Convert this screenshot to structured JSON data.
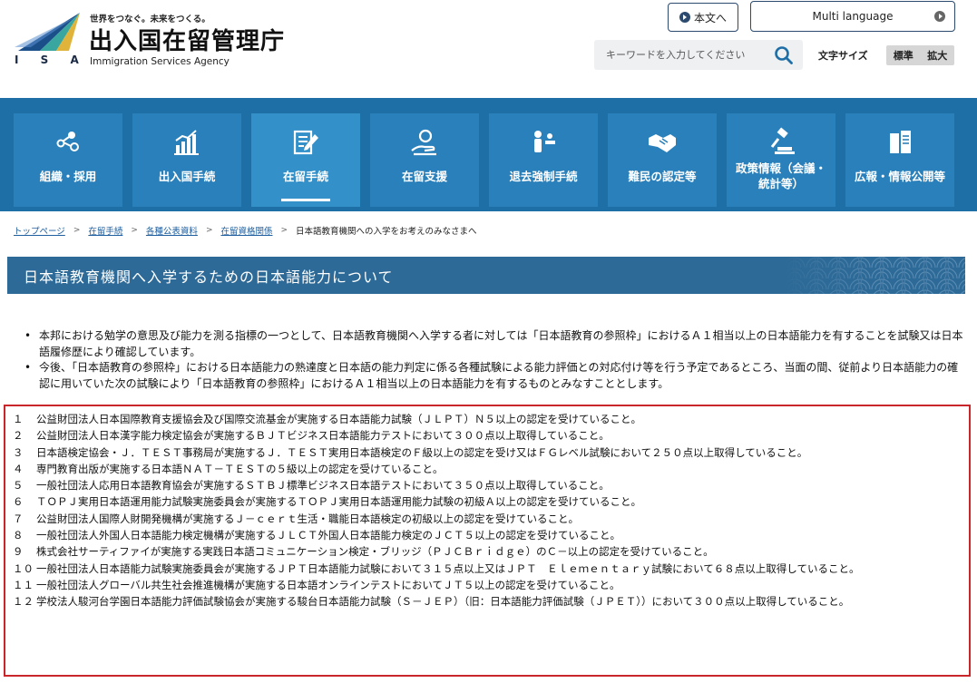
{
  "header": {
    "tagline": "世界をつなぐ。未来をつくる。",
    "agency_name": "出入国在留管理庁",
    "agency_english": "Immigration Services Agency",
    "logo_abbr": "I S A",
    "honbun_label": "本文へ",
    "multi_language_label": "Multi language",
    "search_placeholder": "キーワードを入力してください",
    "font_size_label": "文字サイズ",
    "font_size_options": [
      "標準",
      "拡大"
    ]
  },
  "nav": {
    "items": [
      {
        "label": "組織・採用",
        "icon": "organization-icon"
      },
      {
        "label": "出入国手続",
        "icon": "chart-icon"
      },
      {
        "label": "在留手続",
        "icon": "document-pen-icon",
        "active": true
      },
      {
        "label": "在留支援",
        "icon": "support-hand-icon"
      },
      {
        "label": "退去強制手続",
        "icon": "people-icon"
      },
      {
        "label": "難民の認定等",
        "icon": "handshake-icon"
      },
      {
        "label": "政策情報（会議・\n統計等）",
        "icon": "gavel-icon"
      },
      {
        "label": "広報・情報公開等",
        "icon": "books-icon"
      }
    ]
  },
  "breadcrumb": {
    "items": [
      "トップページ",
      "在留手続",
      "各種公表資料",
      "在留資格関係"
    ],
    "current": "日本語教育機関への入学をお考えのみなさまへ"
  },
  "page_title": "日本語教育機関へ入学するための日本語能力について",
  "intro": [
    "本邦における勉学の意思及び能力を測る指標の一つとして、日本語教育機関へ入学する者に対しては「日本語教育の参照枠」におけるＡ１相当以上の日本語能力を有することを試験又は日本語履修歴により確認しています。",
    "今後、「日本語教育の参照枠」における日本語能力の熟達度と日本語の能力判定に係る各種試験による能力評価との対応付け等を行う予定であるところ、当面の間、従前より日本語能力の確認に用いていた次の試験により「日本語教育の参照枠」におけるＡ１相当以上の日本語能力を有するものとみなすこととします。"
  ],
  "requirements": [
    {
      "num": "１",
      "text": "公益財団法人日本国際教育支援協会及び国際交流基金が実施する日本語能力試験（ＪＬＰＴ）Ｎ５以上の認定を受けていること。"
    },
    {
      "num": "２",
      "text": "公益財団法人日本漢字能力検定協会が実施するＢＪＴビジネス日本語能力テストにおいて３００点以上取得していること。"
    },
    {
      "num": "３",
      "text": "日本語検定協会・Ｊ．ＴＥＳＴ事務局が実施するＪ．ＴＥＳＴ実用日本語検定のＦ級以上の認定を受け又はＦＧレベル試験において２５０点以上取得していること。"
    },
    {
      "num": "４",
      "text": "専門教育出版が実施する日本語ＮＡＴ－ＴＥＳＴの５級以上の認定を受けていること。"
    },
    {
      "num": "５",
      "text": "一般社団法人応用日本語教育協会が実施するＳＴＢＪ標準ビジネス日本語テストにおいて３５０点以上取得していること。"
    },
    {
      "num": "６",
      "text": "ＴＯＰＪ実用日本語運用能力試験実施委員会が実施するＴＯＰＪ実用日本語運用能力試験の初級Ａ以上の認定を受けていること。"
    },
    {
      "num": "７",
      "text": "公益財団法人国際人財開発機構が実施するＪ－ｃｅｒｔ生活・職能日本語検定の初級以上の認定を受けていること。"
    },
    {
      "num": "８",
      "text": "一般社団法人外国人日本語能力検定機構が実施するＪＬＣＴ外国人日本語能力検定のＪＣＴ５以上の認定を受けていること。"
    },
    {
      "num": "９",
      "text": "株式会社サーティファイが実施する実践日本語コミュニケーション検定・ブリッジ（ＰＪＣＢｒｉｄｇｅ）のＣ－以上の認定を受けていること。"
    },
    {
      "num": "１０",
      "text": "一般社団法人日本語能力試験実施委員会が実施するＪＰＴ日本語能力試験において３１５点以上又はＪＰＴ　Ｅｌｅｍｅｎｔａｒｙ試験において６８点以上取得していること。"
    },
    {
      "num": "１１",
      "text": "一般社団法人グローバル共生社会推進機構が実施する日本語オンラインテストにおいてＪＴ５以上の認定を受けていること。"
    },
    {
      "num": "１２",
      "text": "学校法人駿河台学園日本語能力評価試験協会が実施する駿台日本語能力試験（Ｓ－ＪＥＰ）（旧：日本語能力評価試験（ＪＰＥＴ））において３００点以上取得していること。"
    }
  ],
  "colors": {
    "nav_bg": "#1f6fa7",
    "nav_tile": "#2a80ba",
    "title_bar": "#2e6a97",
    "highlight_border": "#c8262b"
  }
}
